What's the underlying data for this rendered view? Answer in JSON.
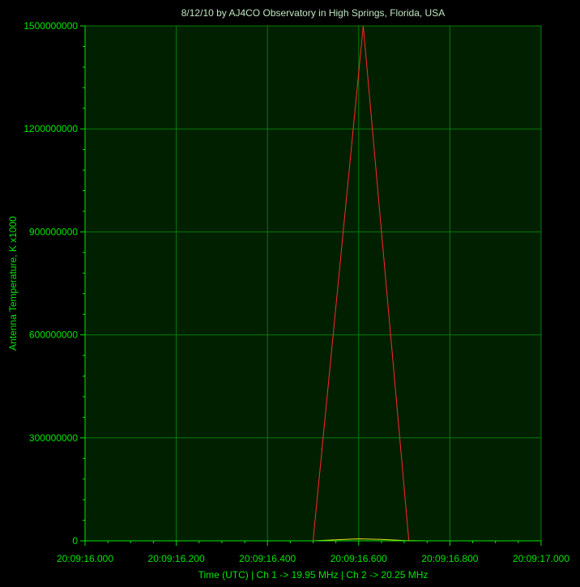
{
  "chart_data": {
    "type": "line",
    "title": "8/12/10  by  AJ4CO Observatory  in  High Springs, Florida, USA",
    "xlabel": "Time (UTC)  |  Ch 1 -> 19.95 MHz  |  Ch 2 -> 20.25 MHz",
    "ylabel": "Antenna Temperature, K x1000",
    "x_ticks": [
      "20:09:16.000",
      "20:09:16.200",
      "20:09:16.400",
      "20:09:16.600",
      "20:09:16.800",
      "20:09:17.000"
    ],
    "y_ticks": [
      "0",
      "300000000",
      "600000000",
      "900000000",
      "1200000000",
      "1500000000"
    ],
    "xlim_seconds": [
      16.0,
      17.0
    ],
    "ylim": [
      0,
      1500000000
    ],
    "grid": true,
    "series": [
      {
        "color": "#ff2a2a",
        "x_seconds": [
          16.0,
          16.5,
          16.61,
          16.71,
          16.75,
          17.0
        ],
        "values": [
          0,
          0,
          1500000000,
          0,
          0,
          0
        ]
      },
      {
        "color": "#e8e820",
        "x_seconds": [
          16.0,
          16.5,
          16.55,
          16.6,
          16.65,
          16.7,
          16.75,
          17.0
        ],
        "values": [
          0,
          0,
          3000000,
          6000000,
          4000000,
          1000000,
          0,
          0
        ]
      }
    ],
    "colors": {
      "background": "#000000",
      "plot_background": "#002000",
      "grid": "#0a7a0a",
      "text": "#00e600",
      "title_text": "#bfe6bf"
    }
  }
}
